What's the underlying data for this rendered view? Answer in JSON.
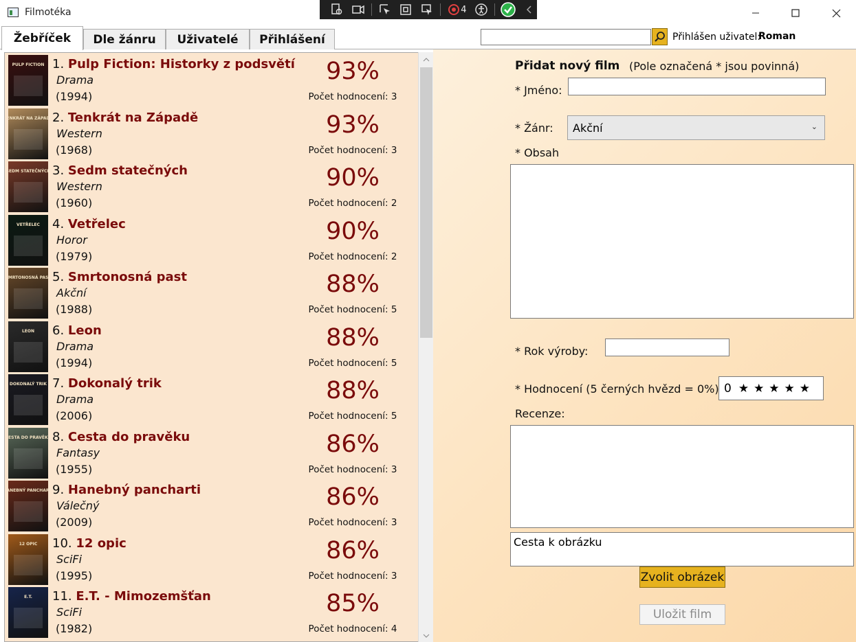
{
  "window": {
    "title": "Filmotéka"
  },
  "devtools": {
    "counter": "4"
  },
  "tabs": [
    {
      "label": "Žebříček"
    },
    {
      "label": "Dle žánru"
    },
    {
      "label": "Uživatelé"
    },
    {
      "label": "Přihlášení"
    }
  ],
  "header": {
    "search_value": "",
    "user_label": "Přihlášen uživatel:",
    "user_name": "Roman"
  },
  "movies": [
    {
      "rank": "1.",
      "title": "Pulp Fiction: Historky z podsvětí",
      "genre": "Drama",
      "year": "(1994)",
      "percent": "93%",
      "count": "Počet hodnocení: 3",
      "poster_color": "#3a1010",
      "poster_text": "PULP FICTION"
    },
    {
      "rank": "2.",
      "title": "Tenkrát na Západě",
      "genre": "Western",
      "year": "(1968)",
      "percent": "93%",
      "count": "Počet hodnocení: 3",
      "poster_color": "#b08a5a",
      "poster_text": "TENKRÁT NA ZÁPADĚ"
    },
    {
      "rank": "3.",
      "title": "Sedm statečných",
      "genre": "Western",
      "year": "(1960)",
      "percent": "90%",
      "count": "Počet hodnocení: 2",
      "poster_color": "#7a3a28",
      "poster_text": "SEDM STATEČNÝCH"
    },
    {
      "rank": "4.",
      "title": "Vetřelec",
      "genre": "Horor",
      "year": "(1979)",
      "percent": "90%",
      "count": "Počet hodnocení: 2",
      "poster_color": "#0b1a12",
      "poster_text": "VETŘELEC"
    },
    {
      "rank": "5.",
      "title": "Smrtonosná past",
      "genre": "Akční",
      "year": "(1988)",
      "percent": "88%",
      "count": "Počet hodnocení: 5",
      "poster_color": "#6a4a2a",
      "poster_text": "SMRTONOSNÁ PAST"
    },
    {
      "rank": "6.",
      "title": "Leon",
      "genre": "Drama",
      "year": "(1994)",
      "percent": "88%",
      "count": "Počet hodnocení: 5",
      "poster_color": "#2a2a2a",
      "poster_text": "LEON"
    },
    {
      "rank": "7.",
      "title": "Dokonalý trik",
      "genre": "Drama",
      "year": "(2006)",
      "percent": "88%",
      "count": "Počet hodnocení: 5",
      "poster_color": "#1a1a22",
      "poster_text": "DOKONALÝ TRIK"
    },
    {
      "rank": "8.",
      "title": "Cesta do pravěku",
      "genre": "Fantasy",
      "year": "(1955)",
      "percent": "86%",
      "count": "Počet hodnocení: 3",
      "poster_color": "#5a6a5a",
      "poster_text": "CESTA DO PRAVĚKU"
    },
    {
      "rank": "9.",
      "title": "Hanebný pancharti",
      "genre": "Válečný",
      "year": "(2009)",
      "percent": "86%",
      "count": "Počet hodnocení: 3",
      "poster_color": "#6a2a1a",
      "poster_text": "HANEBNÝ PANCHARTI"
    },
    {
      "rank": "10.",
      "title": "12 opic",
      "genre": "SciFi",
      "year": "(1995)",
      "percent": "86%",
      "count": "Počet hodnocení: 3",
      "poster_color": "#a05a1a",
      "poster_text": "12 OPIC"
    },
    {
      "rank": "11.",
      "title": "E.T. - Mimozemšťan",
      "genre": "SciFi",
      "year": "(1982)",
      "percent": "85%",
      "count": "Počet hodnocení: 4",
      "poster_color": "#16244a",
      "poster_text": "E.T."
    }
  ],
  "form": {
    "heading": "Přidat nový film",
    "required_note": "(Pole označená * jsou povinná)",
    "name_label": "* Jméno:",
    "name_value": "",
    "genre_label": "* Žánr:",
    "genre_value": "Akční",
    "content_label": "* Obsah",
    "year_label": "* Rok výroby:",
    "rating_label": "* Hodnocení (5 černých hvězd = 0%):",
    "rating_value": "0",
    "rating_stars": "★★★★★",
    "review_label": "Recenze:",
    "image_path": "Cesta k obrázku",
    "choose_image_label": "Zvolit obrázek",
    "save_label": "Uložit film"
  },
  "colors": {
    "accent": "#7a0b0b",
    "button": "#e6b21f",
    "list_background": "#fbe6cf"
  }
}
